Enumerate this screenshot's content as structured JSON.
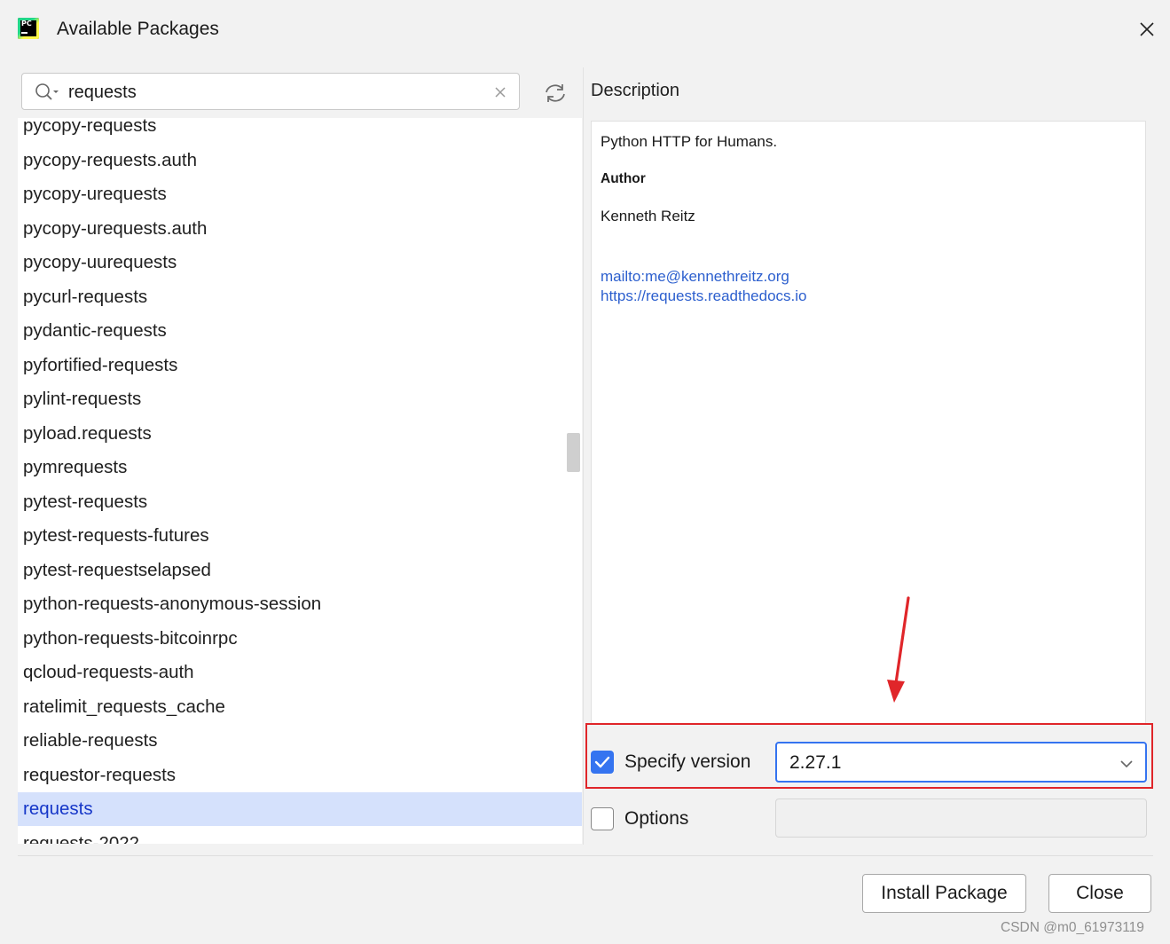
{
  "window": {
    "title": "Available Packages",
    "close_icon": "close-icon",
    "app_icon_text": "PC"
  },
  "search": {
    "value": "requests",
    "search_icon": "search-icon",
    "clear_icon": "clear-icon",
    "refresh_icon": "refresh-icon"
  },
  "packages": {
    "items": [
      "pycopy-requests",
      "pycopy-requests.auth",
      "pycopy-urequests",
      "pycopy-urequests.auth",
      "pycopy-uurequests",
      "pycurl-requests",
      "pydantic-requests",
      "pyfortified-requests",
      "pylint-requests",
      "pyload.requests",
      "pymrequests",
      "pytest-requests",
      "pytest-requests-futures",
      "pytest-requestselapsed",
      "python-requests-anonymous-session",
      "python-requests-bitcoinrpc",
      "qcloud-requests-auth",
      "ratelimit_requests_cache",
      "reliable-requests",
      "requestor-requests",
      "requests",
      "requests-2022"
    ],
    "selected": "requests"
  },
  "description": {
    "label": "Description",
    "summary": "Python HTTP for Humans.",
    "author_label": "Author",
    "author_name": "Kenneth Reitz",
    "links": [
      "mailto:me@kennethreitz.org",
      "https://requests.readthedocs.io"
    ]
  },
  "version": {
    "checked": true,
    "label": "Specify version",
    "value": "2.27.1",
    "chevron_icon": "chevron-down-icon"
  },
  "options": {
    "checked": false,
    "label": "Options",
    "value": ""
  },
  "buttons": {
    "install": "Install Package",
    "close": "Close"
  },
  "colors": {
    "accent": "#3574f0",
    "selection_bg": "#d5e1fc",
    "selection_text": "#1536c8",
    "link": "#2c5fce",
    "annotation_red": "#e0262a"
  },
  "watermark": "CSDN @m0_61973119"
}
